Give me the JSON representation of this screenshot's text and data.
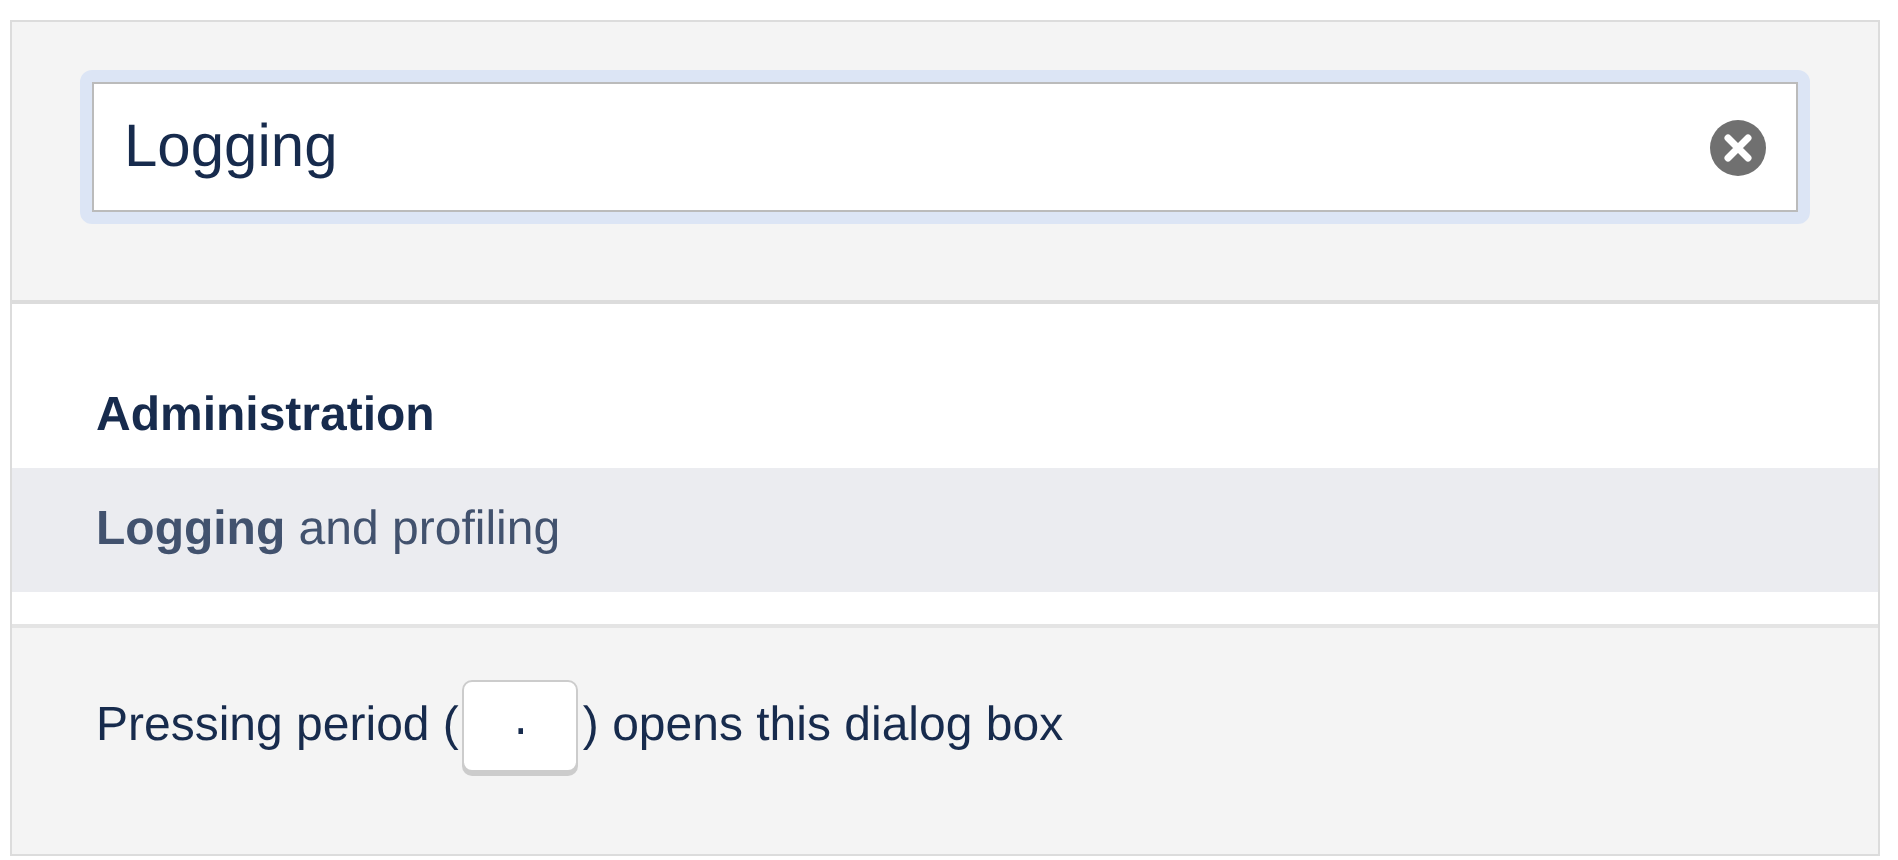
{
  "search": {
    "value": "Logging",
    "focused": true
  },
  "results": [
    {
      "section": "Administration",
      "items": [
        {
          "label": "**Logging** and profiling",
          "selected": true
        }
      ]
    }
  ],
  "footer": {
    "before": "Pressing period (",
    "key": ".",
    "after": ") opens this dialog box"
  }
}
